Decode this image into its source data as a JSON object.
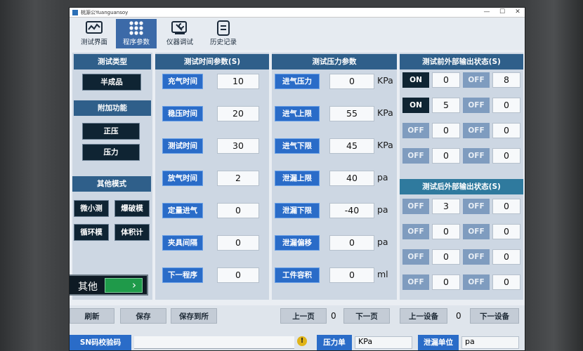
{
  "window": {
    "title": "桃源公Yuanguansoy",
    "min": "—",
    "max": "☐",
    "close": "✕"
  },
  "toolbar": [
    {
      "label": "测试界面",
      "icon": "chart-monitor-icon"
    },
    {
      "label": "程序参数",
      "icon": "grid-dots-icon",
      "active": true
    },
    {
      "label": "仪器调试",
      "icon": "wrench-screen-icon"
    },
    {
      "label": "历史记录",
      "icon": "document-list-icon"
    }
  ],
  "left": {
    "test_type_header": "测试类型",
    "test_type_value": "半成品",
    "aux_header": "附加功能",
    "aux_buttons": [
      "正压",
      "压力"
    ],
    "other_header": "其他模式",
    "other_buttons": [
      "微小测",
      "爆破模",
      "循环模",
      "体积计"
    ],
    "other_switch_label": "其他",
    "other_switch_arrow": "›"
  },
  "time": {
    "header": "测试时间参数(S)",
    "rows": [
      {
        "label": "充气时间",
        "value": "10"
      },
      {
        "label": "稳压时间",
        "value": "20"
      },
      {
        "label": "测试时间",
        "value": "30"
      },
      {
        "label": "放气时间",
        "value": "2"
      },
      {
        "label": "定量进气",
        "value": "0"
      },
      {
        "label": "夹具间隔",
        "value": "0"
      },
      {
        "label": "下一程序",
        "value": "0"
      }
    ]
  },
  "pressure": {
    "header": "测试压力参数",
    "rows": [
      {
        "label": "进气压力",
        "value": "0",
        "unit": "KPa"
      },
      {
        "label": "进气上限",
        "value": "55",
        "unit": "KPa"
      },
      {
        "label": "进气下限",
        "value": "45",
        "unit": "KPa"
      },
      {
        "label": "泄漏上限",
        "value": "40",
        "unit": "pa"
      },
      {
        "label": "泄漏下限",
        "value": "-40",
        "unit": "pa"
      },
      {
        "label": "泄漏偏移",
        "value": "0",
        "unit": "pa"
      },
      {
        "label": "工件容积",
        "value": "0",
        "unit": "ml"
      }
    ]
  },
  "pre_output": {
    "header": "测试前外部输出状态(S)",
    "rows": [
      {
        "a": "ON",
        "a_val": "0",
        "b": "OFF",
        "b_val": "8"
      },
      {
        "a": "ON",
        "a_val": "5",
        "b": "OFF",
        "b_val": "0"
      },
      {
        "a": "OFF",
        "a_val": "0",
        "b": "OFF",
        "b_val": "0"
      },
      {
        "a": "OFF",
        "a_val": "0",
        "b": "OFF",
        "b_val": "0"
      }
    ]
  },
  "post_output": {
    "header": "测试后外部输出状态(S)",
    "rows": [
      {
        "a": "OFF",
        "a_val": "3",
        "b": "OFF",
        "b_val": "0"
      },
      {
        "a": "OFF",
        "a_val": "0",
        "b": "OFF",
        "b_val": "0"
      },
      {
        "a": "OFF",
        "a_val": "0",
        "b": "OFF",
        "b_val": "0"
      },
      {
        "a": "OFF",
        "a_val": "0",
        "b": "OFF",
        "b_val": "0"
      }
    ]
  },
  "bottom": {
    "refresh": "刷新",
    "save": "保存",
    "save_to": "保存到所",
    "prev_page": "上一页",
    "page_num": "0",
    "next_page": "下一页",
    "prev_device": "上一设备",
    "device_num": "0",
    "next_device": "下一设备",
    "sn_label": "SN码校验码",
    "sn_value": "",
    "warn": "!",
    "pressure_unit_label": "压力单",
    "pressure_unit_value": "KPa",
    "leak_unit_label": "泄漏单位",
    "leak_unit_value": "pa"
  },
  "colors": {
    "header": "#2f5f8a",
    "label_blue": "#2a6cc8",
    "dark_button": "#0f2433",
    "off": "#7f9cbf",
    "green": "#1f9a4a"
  }
}
